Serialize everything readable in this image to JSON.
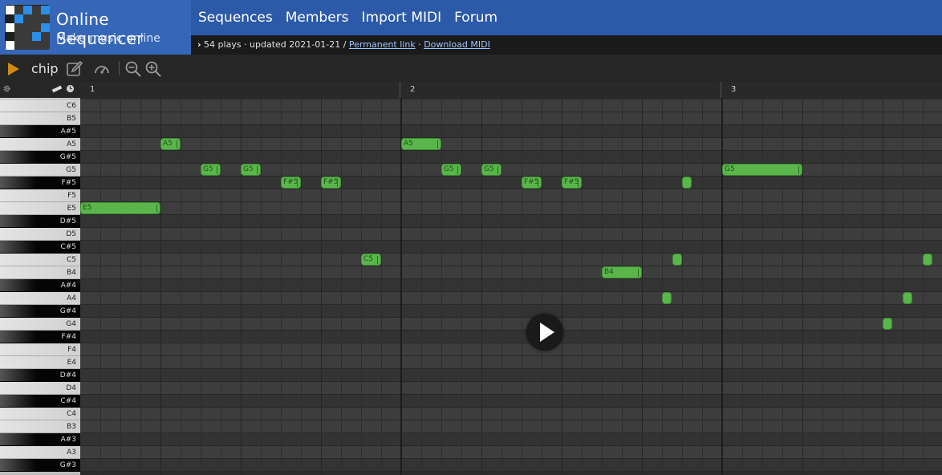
{
  "brand": {
    "title": "Online Sequencer",
    "subtitle": "Make music online"
  },
  "nav": [
    {
      "label": "Sequences"
    },
    {
      "label": "Members"
    },
    {
      "label": "Import MIDI"
    },
    {
      "label": "Forum"
    }
  ],
  "info": {
    "chevron": "›",
    "stats": " 54 plays · updated 2021-01-21 / ",
    "permanent_link": "Permanent link",
    "separator": " · ",
    "download_midi": "Download MIDI"
  },
  "toolbar": {
    "instrument": "chip",
    "icons": [
      "play-icon",
      "edit-icon",
      "speedometer-icon",
      "zoom-out-icon",
      "zoom-in-icon"
    ],
    "accent": "#d08a18"
  },
  "ruler": {
    "bars": [
      "1",
      "2",
      "3"
    ]
  },
  "keys": [
    {
      "name": "C6",
      "black": false
    },
    {
      "name": "B5",
      "black": false
    },
    {
      "name": "A#5",
      "black": true
    },
    {
      "name": "A5",
      "black": false
    },
    {
      "name": "G#5",
      "black": true
    },
    {
      "name": "G5",
      "black": false
    },
    {
      "name": "F#5",
      "black": true
    },
    {
      "name": "F5",
      "black": false
    },
    {
      "name": "E5",
      "black": false
    },
    {
      "name": "D#5",
      "black": true
    },
    {
      "name": "D5",
      "black": false
    },
    {
      "name": "C#5",
      "black": true
    },
    {
      "name": "C5",
      "black": false
    },
    {
      "name": "B4",
      "black": false
    },
    {
      "name": "A#4",
      "black": true
    },
    {
      "name": "A4",
      "black": false
    },
    {
      "name": "G#4",
      "black": true
    },
    {
      "name": "G4",
      "black": false
    },
    {
      "name": "F#4",
      "black": true
    },
    {
      "name": "F4",
      "black": false
    },
    {
      "name": "E4",
      "black": false
    },
    {
      "name": "D#4",
      "black": true
    },
    {
      "name": "D4",
      "black": false
    },
    {
      "name": "C#4",
      "black": true
    },
    {
      "name": "C4",
      "black": false
    },
    {
      "name": "B3",
      "black": false
    },
    {
      "name": "A#3",
      "black": true
    },
    {
      "name": "A3",
      "black": false
    },
    {
      "name": "G#3",
      "black": true
    }
  ],
  "notes": [
    {
      "label": "E5",
      "pitch": "E5",
      "start": 0,
      "length": 4
    },
    {
      "label": "A5",
      "pitch": "A5",
      "start": 4,
      "length": 1
    },
    {
      "label": "G5",
      "pitch": "G5",
      "start": 6,
      "length": 1
    },
    {
      "label": "G5",
      "pitch": "G5",
      "start": 8,
      "length": 1
    },
    {
      "label": "F#5",
      "pitch": "F#5",
      "start": 10,
      "length": 1
    },
    {
      "label": "F#5",
      "pitch": "F#5",
      "start": 12,
      "length": 1
    },
    {
      "label": "C5",
      "pitch": "C5",
      "start": 14,
      "length": 1
    },
    {
      "label": "A5",
      "pitch": "A5",
      "start": 16,
      "length": 2
    },
    {
      "label": "G5",
      "pitch": "G5",
      "start": 18,
      "length": 1
    },
    {
      "label": "G5",
      "pitch": "G5",
      "start": 20,
      "length": 1
    },
    {
      "label": "F#5",
      "pitch": "F#5",
      "start": 22,
      "length": 1
    },
    {
      "label": "F#5",
      "pitch": "F#5",
      "start": 24,
      "length": 1
    },
    {
      "label": "B4",
      "pitch": "B4",
      "start": 26,
      "length": 2
    },
    {
      "label": "",
      "pitch": "A4",
      "start": 29,
      "length": 0.5
    },
    {
      "label": "",
      "pitch": "C5",
      "start": 29.5,
      "length": 0.5
    },
    {
      "label": "",
      "pitch": "F#5",
      "start": 30,
      "length": 0.5
    },
    {
      "label": "G5",
      "pitch": "G5",
      "start": 32,
      "length": 4
    },
    {
      "label": "",
      "pitch": "G4",
      "start": 40,
      "length": 0.5
    },
    {
      "label": "",
      "pitch": "A4",
      "start": 41,
      "length": 0.5
    },
    {
      "label": "",
      "pitch": "C5",
      "start": 42,
      "length": 0.5
    }
  ],
  "colors": {
    "header": "#2c5aa8",
    "note": "#5ab54b",
    "link": "#9fc3ff"
  }
}
